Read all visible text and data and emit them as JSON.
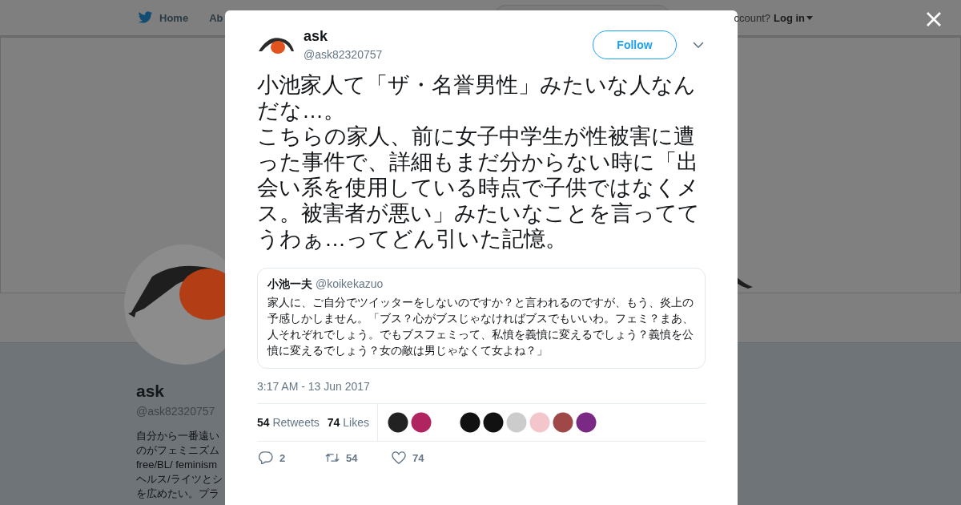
{
  "background": {
    "nav": [
      {
        "label": "Home",
        "selected": false
      },
      {
        "label": "Ab",
        "selected": false
      }
    ],
    "account_prompt": "ccount?",
    "login": "Log in",
    "profile": {
      "name": "ask",
      "handle": "@ask82320757",
      "bio": [
        "自分から一番遠い",
        "のがフェミニズム",
        "free/BL/ feminism",
        "ヘルス/ライツとシ",
        "を広めたい。プラ"
      ]
    }
  },
  "tweet": {
    "name": "ask",
    "handle": "@ask82320757",
    "follow": "Follow",
    "text": [
      "小池家人て「ザ・名誉男性」みたいな人なんだな…。",
      "こちらの家人、前に女子中学生が性被害に遭った事件で、詳細もまだ分からない時に「出会い系を使用している時点で子供ではなくメス。被害者が悪い」みたいなことを言っててうわぁ…ってどん引いた記憶。"
    ],
    "quote": {
      "name": "小池一夫",
      "handle": "@koikekazuo",
      "text": "家人に、ご自分でツイッターをしないのですか？と言われるのですが、もう、炎上の予感しかしません。「ブス？心がブスじゃなければブスでもいいわ。フェミ？まあ、人それぞれでしょう。でもブスフェミって、私憤を義憤に変えるでしょう？義憤を公憤に変えるでしょう？女の敵は男じゃなくて女よね？」"
    },
    "time": "3:17 AM - 13 Jun 2017",
    "stats": [
      {
        "count": "54",
        "label": "Retweets"
      },
      {
        "count": "74",
        "label": "Likes"
      }
    ],
    "likers": [
      {
        "color": "#222222"
      },
      {
        "color": "#b0245f"
      },
      {
        "color": "#111111"
      },
      {
        "color": "#111111"
      },
      {
        "color": "#cccccc"
      },
      {
        "color": "#f3c6cc"
      },
      {
        "color": "#a04848"
      },
      {
        "color": "#7a2a84"
      }
    ],
    "actions": [
      {
        "kind": "reply",
        "count": "2"
      },
      {
        "kind": "retweet",
        "count": "54"
      },
      {
        "kind": "like",
        "count": "74"
      }
    ]
  }
}
